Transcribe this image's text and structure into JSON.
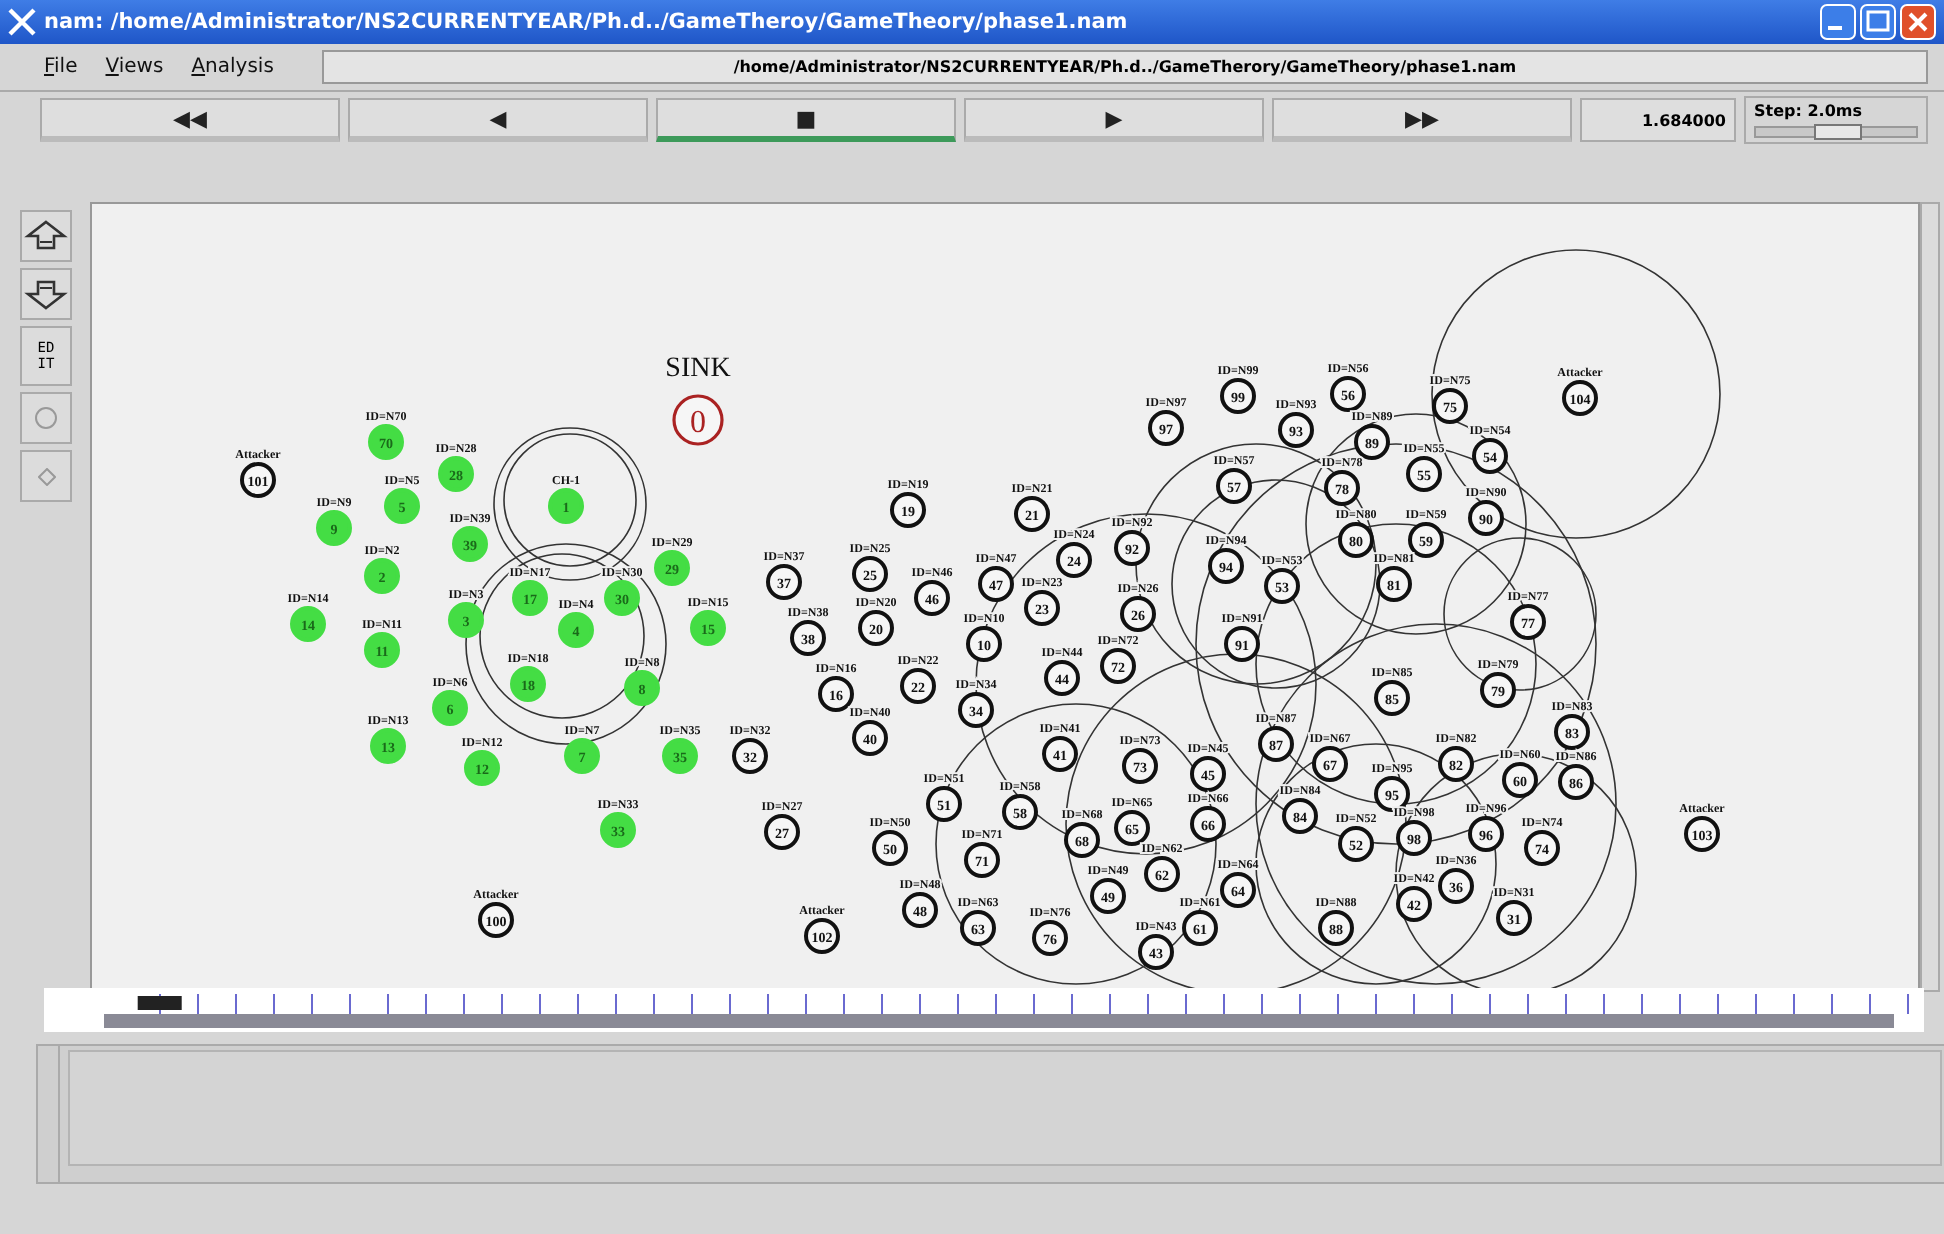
{
  "window": {
    "title": "nam: /home/Administrator/NS2CURRENTYEAR/Ph.d../GameTheroy/GameTheory/phase1.nam"
  },
  "menu": [
    {
      "label": "File"
    },
    {
      "label": "Views"
    },
    {
      "label": "Analysis"
    }
  ],
  "file_path": "/home/Administrator/NS2CURRENTYEAR/Ph.d../GameTherory/GameTheory/phase1.nam",
  "playback": {
    "buttons": [
      {
        "label": "◀◀",
        "selected": false
      },
      {
        "label": "◀",
        "selected": false
      },
      {
        "label": "■",
        "selected": true
      },
      {
        "label": "▶",
        "selected": false
      },
      {
        "label": "▶▶",
        "selected": false
      }
    ],
    "time": "1.684000",
    "step": {
      "label": "Step: 2.0ms",
      "level": 0.5
    }
  },
  "timeline": {
    "level": 0.03
  },
  "tools": [
    {
      "kind": "zoom_in"
    },
    {
      "kind": "zoom_out"
    },
    {
      "kind": "edit",
      "label": "EDIT"
    },
    {
      "kind": "circle"
    },
    {
      "kind": "diamond"
    }
  ],
  "nodes": [
    {
      "label": "SINK",
      "number": "0",
      "color": "#aa2222",
      "kind": "sink"
    },
    {
      "label": "Attacker",
      "number": "101",
      "color": "#111111",
      "kind": "node"
    },
    {
      "label": "ID=N70",
      "number": "70",
      "color": "#44dd44",
      "kind": "member"
    },
    {
      "label": "ID=N28",
      "number": "28",
      "color": "#44dd44",
      "kind": "member"
    },
    {
      "label": "ID=N5",
      "number": "5",
      "color": "#44dd44",
      "kind": "member"
    },
    {
      "label": "ID=N9",
      "number": "9",
      "color": "#44dd44",
      "kind": "member"
    },
    {
      "label": "CH-1",
      "number": "1",
      "color": "#44dd44",
      "kind": "member"
    },
    {
      "label": "ID=N39",
      "number": "39",
      "color": "#44dd44",
      "kind": "member"
    },
    {
      "label": "ID=N2",
      "number": "2",
      "color": "#44dd44",
      "kind": "member"
    },
    {
      "label": "ID=N14",
      "number": "14",
      "color": "#44dd44",
      "kind": "member"
    },
    {
      "label": "ID=N11",
      "number": "11",
      "color": "#44dd44",
      "kind": "member"
    },
    {
      "label": "ID=N3",
      "number": "3",
      "color": "#44dd44",
      "kind": "member"
    },
    {
      "label": "ID=N17",
      "number": "17",
      "color": "#44dd44",
      "kind": "member"
    },
    {
      "label": "ID=N4",
      "number": "4",
      "color": "#44dd44",
      "kind": "member"
    },
    {
      "label": "ID=N30",
      "number": "30",
      "color": "#44dd44",
      "kind": "member"
    },
    {
      "label": "ID=N29",
      "number": "29",
      "color": "#44dd44",
      "kind": "member"
    },
    {
      "label": "ID=N15",
      "number": "15",
      "color": "#44dd44",
      "kind": "member"
    },
    {
      "label": "ID=N18",
      "number": "18",
      "color": "#44dd44",
      "kind": "member"
    },
    {
      "label": "ID=N8",
      "number": "8",
      "color": "#44dd44",
      "kind": "member"
    },
    {
      "label": "ID=N6",
      "number": "6",
      "color": "#44dd44",
      "kind": "member"
    },
    {
      "label": "ID=N13",
      "number": "13",
      "color": "#44dd44",
      "kind": "member"
    },
    {
      "label": "ID=N12",
      "number": "12",
      "color": "#44dd44",
      "kind": "member"
    },
    {
      "label": "ID=N7",
      "number": "7",
      "color": "#44dd44",
      "kind": "member"
    },
    {
      "label": "ID=N35",
      "number": "35",
      "color": "#44dd44",
      "kind": "member"
    },
    {
      "label": "ID=N33",
      "number": "33",
      "color": "#44dd44",
      "kind": "member"
    },
    {
      "label": "Attacker",
      "number": "100",
      "color": "#111111",
      "kind": "node"
    },
    {
      "label": "ID=N32",
      "number": "32",
      "color": "#111111",
      "kind": "node"
    },
    {
      "label": "ID=N37",
      "number": "37",
      "color": "#111111",
      "kind": "node"
    },
    {
      "label": "ID=N27",
      "number": "27",
      "color": "#111111",
      "kind": "node"
    },
    {
      "label": "ID=N25",
      "number": "25",
      "color": "#111111",
      "kind": "node"
    },
    {
      "label": "ID=N46",
      "number": "46",
      "color": "#111111",
      "kind": "node"
    },
    {
      "label": "ID=N20",
      "number": "20",
      "color": "#111111",
      "kind": "node"
    },
    {
      "label": "ID=N38",
      "number": "38",
      "color": "#111111",
      "kind": "node"
    },
    {
      "label": "ID=N16",
      "number": "16",
      "color": "#111111",
      "kind": "node"
    },
    {
      "label": "ID=N22",
      "number": "22",
      "color": "#111111",
      "kind": "node"
    },
    {
      "label": "ID=N40",
      "number": "40",
      "color": "#111111",
      "kind": "node"
    },
    {
      "label": "ID=N19",
      "number": "19",
      "color": "#111111",
      "kind": "node"
    },
    {
      "label": "ID=N21",
      "number": "21",
      "color": "#111111",
      "kind": "node"
    },
    {
      "label": "ID=N24",
      "number": "24",
      "color": "#111111",
      "kind": "node"
    },
    {
      "label": "ID=N47",
      "number": "47",
      "color": "#111111",
      "kind": "node"
    },
    {
      "label": "ID=N23",
      "number": "23",
      "color": "#111111",
      "kind": "node"
    },
    {
      "label": "ID=N10",
      "number": "10",
      "color": "#111111",
      "kind": "node"
    },
    {
      "label": "ID=N34",
      "number": "34",
      "color": "#111111",
      "kind": "node"
    },
    {
      "label": "ID=N92",
      "number": "92",
      "color": "#111111",
      "kind": "node"
    },
    {
      "label": "ID=N26",
      "number": "26",
      "color": "#111111",
      "kind": "node"
    },
    {
      "label": "ID=N72",
      "number": "72",
      "color": "#111111",
      "kind": "node"
    },
    {
      "label": "ID=N44",
      "number": "44",
      "color": "#111111",
      "kind": "node"
    },
    {
      "label": "ID=N41",
      "number": "41",
      "color": "#111111",
      "kind": "node"
    },
    {
      "label": "ID=N73",
      "number": "73",
      "color": "#111111",
      "kind": "node"
    },
    {
      "label": "ID=N45",
      "number": "45",
      "color": "#111111",
      "kind": "node"
    },
    {
      "label": "ID=N51",
      "number": "51",
      "color": "#111111",
      "kind": "node"
    },
    {
      "label": "ID=N58",
      "number": "58",
      "color": "#111111",
      "kind": "node"
    },
    {
      "label": "ID=N50",
      "number": "50",
      "color": "#111111",
      "kind": "node"
    },
    {
      "label": "ID=N71",
      "number": "71",
      "color": "#111111",
      "kind": "node"
    },
    {
      "label": "ID=N65",
      "number": "65",
      "color": "#111111",
      "kind": "node"
    },
    {
      "label": "ID=N68",
      "number": "68",
      "color": "#111111",
      "kind": "node"
    },
    {
      "label": "ID=N66",
      "number": "66",
      "color": "#111111",
      "kind": "node"
    },
    {
      "label": "ID=N62",
      "number": "62",
      "color": "#111111",
      "kind": "node"
    },
    {
      "label": "ID=N63",
      "number": "63",
      "color": "#111111",
      "kind": "node"
    },
    {
      "label": "ID=N48",
      "number": "48",
      "color": "#111111",
      "kind": "node"
    },
    {
      "label": "ID=N49",
      "number": "49",
      "color": "#111111",
      "kind": "node"
    },
    {
      "label": "ID=N76",
      "number": "76",
      "color": "#111111",
      "kind": "node"
    },
    {
      "label": "ID=N43",
      "number": "43",
      "color": "#111111",
      "kind": "node"
    },
    {
      "label": "ID=N61",
      "number": "61",
      "color": "#111111",
      "kind": "node"
    },
    {
      "label": "ID=N64",
      "number": "64",
      "color": "#111111",
      "kind": "node"
    },
    {
      "label": "Attacker",
      "number": "102",
      "color": "#111111",
      "kind": "node"
    },
    {
      "label": "ID=N99",
      "number": "99",
      "color": "#111111",
      "kind": "node"
    },
    {
      "label": "ID=N93",
      "number": "93",
      "color": "#111111",
      "kind": "node"
    },
    {
      "label": "ID=N56",
      "number": "56",
      "color": "#111111",
      "kind": "node"
    },
    {
      "label": "ID=N97",
      "number": "97",
      "color": "#111111",
      "kind": "node"
    },
    {
      "label": "ID=N89",
      "number": "89",
      "color": "#111111",
      "kind": "node"
    },
    {
      "label": "ID=N75",
      "number": "75",
      "color": "#111111",
      "kind": "node"
    },
    {
      "label": "ID=N55",
      "number": "55",
      "color": "#111111",
      "kind": "node"
    },
    {
      "label": "ID=N54",
      "number": "54",
      "color": "#111111",
      "kind": "node"
    },
    {
      "label": "ID=N57",
      "number": "57",
      "color": "#111111",
      "kind": "node"
    },
    {
      "label": "ID=N78",
      "number": "78",
      "color": "#111111",
      "kind": "node"
    },
    {
      "label": "ID=N90",
      "number": "90",
      "color": "#111111",
      "kind": "node"
    },
    {
      "label": "ID=N80",
      "number": "80",
      "color": "#111111",
      "kind": "node"
    },
    {
      "label": "ID=N59",
      "number": "59",
      "color": "#111111",
      "kind": "node"
    },
    {
      "label": "ID=N94",
      "number": "94",
      "color": "#111111",
      "kind": "node"
    },
    {
      "label": "ID=N53",
      "number": "53",
      "color": "#111111",
      "kind": "node"
    },
    {
      "label": "ID=N81",
      "number": "81",
      "color": "#111111",
      "kind": "node"
    },
    {
      "label": "ID=N91",
      "number": "91",
      "color": "#111111",
      "kind": "node"
    },
    {
      "label": "ID=N77",
      "number": "77",
      "color": "#111111",
      "kind": "node"
    },
    {
      "label": "ID=N85",
      "number": "85",
      "color": "#111111",
      "kind": "node"
    },
    {
      "label": "ID=N79",
      "number": "79",
      "color": "#111111",
      "kind": "node"
    },
    {
      "label": "ID=N83",
      "number": "83",
      "color": "#111111",
      "kind": "node"
    },
    {
      "label": "ID=N87",
      "number": "87",
      "color": "#111111",
      "kind": "node"
    },
    {
      "label": "ID=N67",
      "number": "67",
      "color": "#111111",
      "kind": "node"
    },
    {
      "label": "ID=N95",
      "number": "95",
      "color": "#111111",
      "kind": "node"
    },
    {
      "label": "ID=N82",
      "number": "82",
      "color": "#111111",
      "kind": "node"
    },
    {
      "label": "ID=N60",
      "number": "60",
      "color": "#111111",
      "kind": "node"
    },
    {
      "label": "ID=N86",
      "number": "86",
      "color": "#111111",
      "kind": "node"
    },
    {
      "label": "ID=N84",
      "number": "84",
      "color": "#111111",
      "kind": "node"
    },
    {
      "label": "ID=N52",
      "number": "52",
      "color": "#111111",
      "kind": "node"
    },
    {
      "label": "ID=N98",
      "number": "98",
      "color": "#111111",
      "kind": "node"
    },
    {
      "label": "ID=N96",
      "number": "96",
      "color": "#111111",
      "kind": "node"
    },
    {
      "label": "ID=N74",
      "number": "74",
      "color": "#111111",
      "kind": "node"
    },
    {
      "label": "ID=N42",
      "number": "42",
      "color": "#111111",
      "kind": "node"
    },
    {
      "label": "ID=N36",
      "number": "36",
      "color": "#111111",
      "kind": "node"
    },
    {
      "label": "ID=N31",
      "number": "31",
      "color": "#111111",
      "kind": "node"
    },
    {
      "label": "ID=N88",
      "number": "88",
      "color": "#111111",
      "kind": "node"
    },
    {
      "label": "Attacker",
      "number": "103",
      "color": "#111111",
      "kind": "node"
    },
    {
      "label": "Attacker",
      "number": "104",
      "color": "#111111",
      "kind": "node"
    }
  ]
}
